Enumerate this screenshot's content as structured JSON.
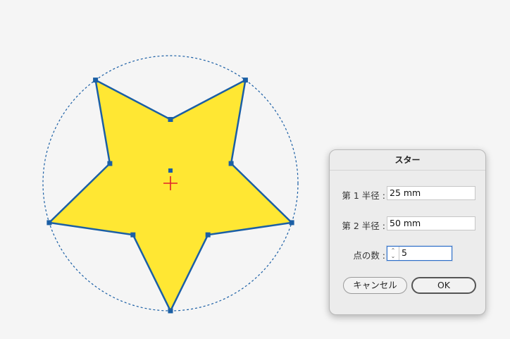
{
  "dialog": {
    "title": "スター",
    "radius1": {
      "label": "第 1 半径 :",
      "value": "25 mm"
    },
    "radius2": {
      "label": "第 2 半径 :",
      "value": "50 mm"
    },
    "points": {
      "label": "点の数 :",
      "value": "5"
    },
    "cancel_label": "キャンセル",
    "ok_label": "OK"
  },
  "icons": {
    "stepper_up": "⌃",
    "stepper_down": "⌄"
  },
  "colors": {
    "star_fill": "#ffe733",
    "star_stroke": "#1b5fa5",
    "anchor": "#1b5fa5",
    "guide_circle": "#1b5fa5",
    "center_mark": "#e0242b",
    "canvas_bg": "#f5f5f5"
  },
  "shape": {
    "points": 5,
    "inner_radius_ratio": 0.5
  }
}
